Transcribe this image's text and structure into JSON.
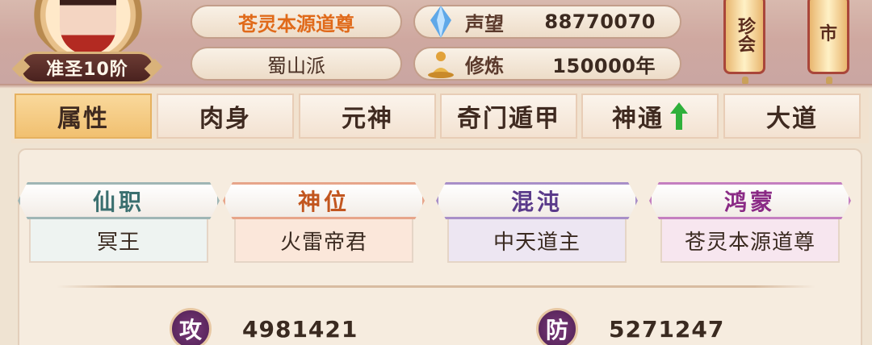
{
  "player": {
    "rank": "准圣10阶",
    "title_name": "苍灵本源道尊",
    "sect": "蜀山派"
  },
  "stats_header": {
    "fame_label": "声望",
    "fame_value": "88770070",
    "cultivation_label": "修炼",
    "cultivation_value": "150000年"
  },
  "side_buttons": {
    "first_label": "珍会",
    "second_label": "市"
  },
  "tabs": [
    {
      "label": "属性",
      "active": true
    },
    {
      "label": "肉身",
      "active": false
    },
    {
      "label": "元神",
      "active": false
    },
    {
      "label": "奇门遁甲",
      "active": false
    },
    {
      "label": "神通",
      "active": false,
      "upgrade_arrow": true
    },
    {
      "label": "大道",
      "active": false
    }
  ],
  "titles": [
    {
      "category": "仙职",
      "value": "冥王"
    },
    {
      "category": "神位",
      "value": "火雷帝君"
    },
    {
      "category": "混沌",
      "value": "中天道主"
    },
    {
      "category": "鸿蒙",
      "value": "苍灵本源道尊"
    }
  ],
  "attributes": {
    "attack_label": "攻",
    "attack_value": "4981421",
    "defense_label": "防",
    "defense_value": "5271247"
  },
  "colors": {
    "accent_orange": "#e06a1a",
    "active_tab": "#f1c070",
    "badge_purple": "#5e2a62",
    "upgrade_green": "#2fb03a"
  },
  "icons": {
    "fame": "blue-crystal-icon",
    "cultivation": "meditation-icon",
    "upgrade": "green-up-arrow-icon"
  }
}
